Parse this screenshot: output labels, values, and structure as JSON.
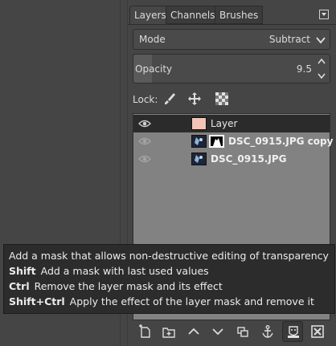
{
  "tabs": [
    {
      "label": "Layers",
      "active": true
    },
    {
      "label": "Channels",
      "active": false
    },
    {
      "label": "Brushes",
      "active": false
    }
  ],
  "mode": {
    "label": "Mode",
    "value": "Subtract"
  },
  "opacity": {
    "label": "Opacity",
    "value": "9.5",
    "fraction": 0.095
  },
  "lock": {
    "label": "Lock:"
  },
  "layers": [
    {
      "name": "Layer",
      "selected": true,
      "visible": true,
      "has_mask": false,
      "thumb_color": "#f2c4b8"
    },
    {
      "name": "DSC_0915.JPG copy",
      "selected": false,
      "visible": true,
      "has_mask": true,
      "thumb_color": "#3b4a66"
    },
    {
      "name": "DSC_0915.JPG",
      "selected": false,
      "visible": true,
      "has_mask": false,
      "thumb_color": "#3b4a66"
    }
  ],
  "tooltip": {
    "line1": "Add a mask that allows non-destructive editing of transparency",
    "line2_key": "Shift",
    "line2_text": "Add a mask with last used values",
    "line3_key": "Ctrl",
    "line3_text": "Remove the layer mask and its effect",
    "line4_key": "Shift+Ctrl",
    "line4_text": "Apply the effect of the layer mask and remove it"
  },
  "bottom_buttons": [
    "new-layer",
    "new-layer-group",
    "raise-layer",
    "lower-layer",
    "duplicate-layer",
    "anchor-layer",
    "add-mask",
    "delete-layer"
  ],
  "colors": {
    "accent_selected": "#2b2b2b",
    "list_bg": "#828282",
    "tooltip_bg": "#2c2c2c"
  }
}
